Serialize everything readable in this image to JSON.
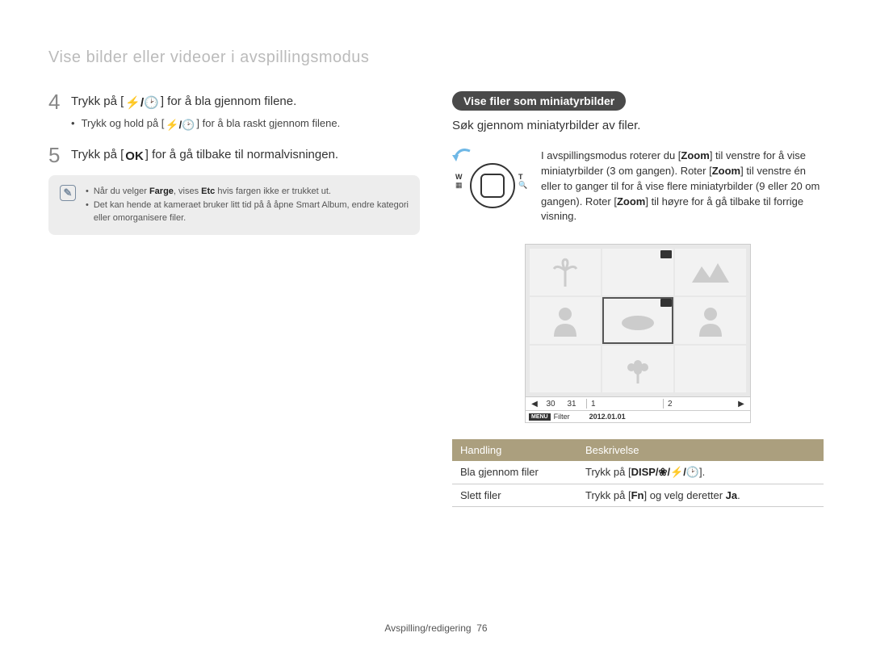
{
  "section_title": "Vise bilder eller videoer i avspillingsmodus",
  "left": {
    "step4": {
      "num": "4",
      "pre": "Trykk på [",
      "icons": "⚡/🕑",
      "post": "] for å bla gjennom filene."
    },
    "step4_sub": {
      "pre": "Trykk og hold på [",
      "icons": "⚡/🕑",
      "post": "] for å bla raskt gjennom filene."
    },
    "step5": {
      "num": "5",
      "pre": "Trykk på [",
      "icon": "OK",
      "post": "] for å gå tilbake til normalvisningen."
    },
    "note1": {
      "pre": "Når du velger ",
      "b1": "Farge",
      "mid": ", vises ",
      "b2": "Etc",
      "post": " hvis fargen ikke er trukket ut."
    },
    "note2": "Det kan hende at kameraet bruker litt tid på å åpne Smart Album, endre kategori eller omorganisere filer."
  },
  "right": {
    "pill": "Vise filer som miniatyrbilder",
    "intro": "Søk gjennom miniatyrbilder av filer.",
    "zoom_text": {
      "pre": "I avspillingsmodus roterer du [",
      "z1": "Zoom",
      "m1": "] til venstre for å vise miniatyrbilder (3 om gangen). Roter [",
      "z2": "Zoom",
      "m2": "] til venstre én eller to ganger til for å vise flere miniatyrbilder (9 eller 20 om gangen). Roter [",
      "z3": "Zoom",
      "m3": "] til høyre for å gå tilbake til forrige visning."
    },
    "bar": {
      "d30": "30",
      "d31": "31",
      "d1": "1",
      "d2": "2"
    },
    "status": {
      "menu": "MENU",
      "filter": "Filter",
      "date": "2012.01.01"
    },
    "table": {
      "h1": "Handling",
      "h2": "Beskrivelse",
      "r1c1": "Bla gjennom filer",
      "r1c2_pre": "Trykk på [",
      "r1c2_icon": "DISP/❀/⚡/🕑",
      "r1c2_post": "].",
      "r2c1": "Slett filer",
      "r2c2_pre": "Trykk på [",
      "r2c2_icon": "Fn",
      "r2c2_mid": "] og velg deretter ",
      "r2c2_b": "Ja",
      "r2c2_post": "."
    }
  },
  "footer": {
    "label": "Avspilling/redigering",
    "page": "76"
  }
}
